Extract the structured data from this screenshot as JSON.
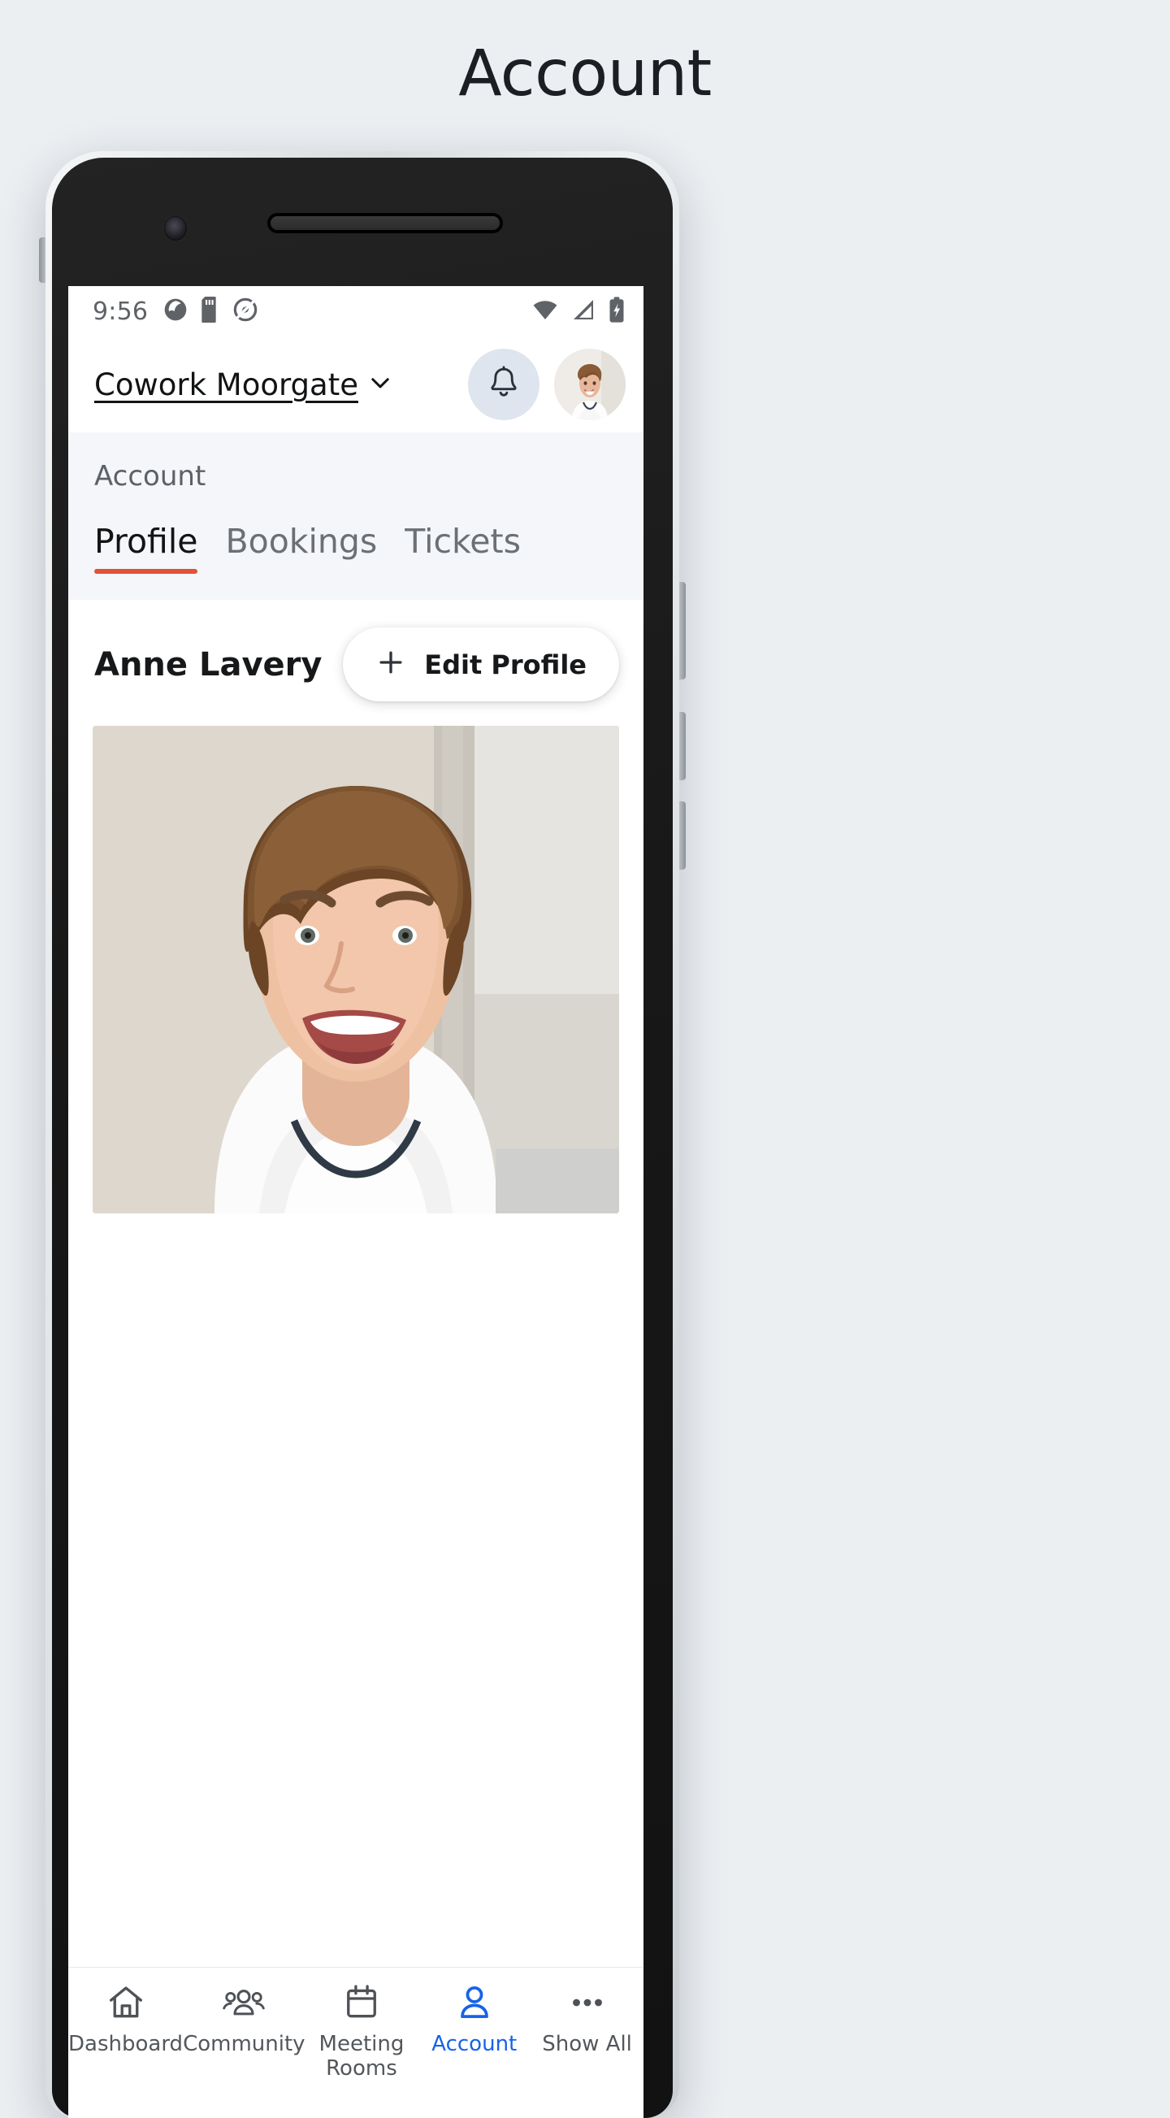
{
  "page": {
    "title": "Account"
  },
  "status_bar": {
    "time": "9:56",
    "left_icons": [
      "camera-shutter-icon",
      "sd-card-icon",
      "location-disabled-icon"
    ],
    "right_icons": [
      "wifi-icon",
      "cellular-signal-icon",
      "battery-charging-icon"
    ]
  },
  "app_bar": {
    "venue_name": "Cowork Moorgate",
    "venue_chevron": "chevron-down-icon",
    "notifications_icon": "bell-icon",
    "avatar": "user-avatar"
  },
  "sub_header": {
    "label": "Account",
    "tabs": [
      {
        "label": "Profile",
        "active": true
      },
      {
        "label": "Bookings",
        "active": false
      },
      {
        "label": "Tickets",
        "active": false
      }
    ]
  },
  "profile": {
    "name": "Anne Lavery",
    "edit_button": {
      "label": "Edit Profile",
      "icon": "plus-icon"
    },
    "photo_alt": "profile-photo"
  },
  "bottom_nav": [
    {
      "label": "Dashboard",
      "icon": "home-icon",
      "active": false
    },
    {
      "label": "Community",
      "icon": "people-icon",
      "active": false
    },
    {
      "label": "Meeting Rooms",
      "icon": "calendar-icon",
      "active": false
    },
    {
      "label": "Account",
      "icon": "person-icon",
      "active": true
    },
    {
      "label": "Show All",
      "icon": "ellipsis-icon",
      "active": false
    }
  ],
  "colors": {
    "page_background": "#eceff2",
    "tab_accent": "#e2513b",
    "nav_active": "#1763e8",
    "subheader_background": "#f4f6f9",
    "bell_background": "#dfe5ee",
    "status_icon": "#5f6368"
  }
}
